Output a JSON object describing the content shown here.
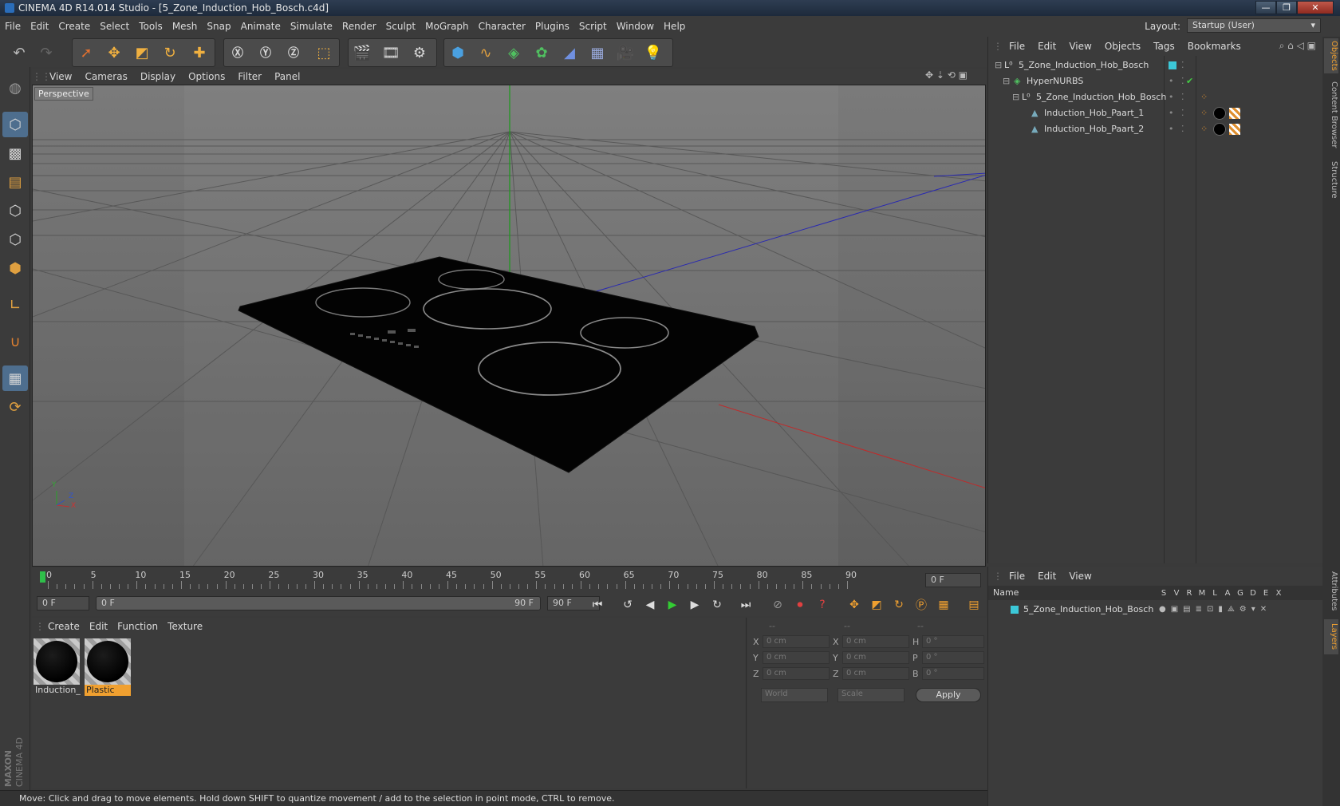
{
  "window": {
    "title": "CINEMA 4D R14.014 Studio - [5_Zone_Induction_Hob_Bosch.c4d]",
    "controls": [
      "—",
      "❐",
      "✕"
    ]
  },
  "menubar": {
    "items": [
      "File",
      "Edit",
      "Create",
      "Select",
      "Tools",
      "Mesh",
      "Snap",
      "Animate",
      "Simulate",
      "Render",
      "Sculpt",
      "MoGraph",
      "Character",
      "Plugins",
      "Script",
      "Window",
      "Help"
    ],
    "layout_label": "Layout:",
    "layout_value": "Startup (User)"
  },
  "viewport": {
    "menu": [
      "View",
      "Cameras",
      "Display",
      "Options",
      "Filter",
      "Panel"
    ],
    "label": "Perspective",
    "axis_labels": {
      "y": "Y",
      "x": "X",
      "z": "Z"
    }
  },
  "timeline": {
    "ticks": [
      "0",
      "5",
      "10",
      "15",
      "20",
      "25",
      "30",
      "35",
      "40",
      "45",
      "50",
      "55",
      "60",
      "65",
      "70",
      "75",
      "80",
      "85",
      "90"
    ],
    "current_frame": "0 F"
  },
  "transport": {
    "start_field": "0 F",
    "range_start": "0 F",
    "range_end": "90 F",
    "end_field": "90 F"
  },
  "materials": {
    "menu": [
      "Create",
      "Edit",
      "Function",
      "Texture"
    ],
    "items": [
      {
        "name": "Induction_",
        "selected": false
      },
      {
        "name": "Plastic",
        "selected": true
      }
    ]
  },
  "coordinates": {
    "headers": [
      "--",
      "--",
      "--"
    ],
    "rows": [
      {
        "a": "X",
        "av": "0 cm",
        "b": "X",
        "bv": "0 cm",
        "c": "H",
        "cv": "0 °"
      },
      {
        "a": "Y",
        "av": "0 cm",
        "b": "Y",
        "bv": "0 cm",
        "c": "P",
        "cv": "0 °"
      },
      {
        "a": "Z",
        "av": "0 cm",
        "b": "Z",
        "bv": "0 cm",
        "c": "B",
        "cv": "0 °"
      }
    ],
    "mode": "World",
    "type": "Scale",
    "apply": "Apply"
  },
  "objects": {
    "menu": [
      "File",
      "Edit",
      "View",
      "Objects",
      "Tags",
      "Bookmarks"
    ],
    "tree": [
      {
        "name": "5_Zone_Induction_Hob_Bosch",
        "level": 0
      },
      {
        "name": "HyperNURBS",
        "level": 1
      },
      {
        "name": "5_Zone_Induction_Hob_Bosch",
        "level": 2
      },
      {
        "name": "Induction_Hob_Paart_1",
        "level": 3
      },
      {
        "name": "Induction_Hob_Paart_2",
        "level": 3
      }
    ]
  },
  "layers": {
    "menu": [
      "File",
      "Edit",
      "View"
    ],
    "name_header": "Name",
    "col_headers": [
      "S",
      "V",
      "R",
      "M",
      "L",
      "A",
      "G",
      "D",
      "E",
      "X"
    ],
    "rows": [
      {
        "name": "5_Zone_Induction_Hob_Bosch"
      }
    ]
  },
  "right_tabs": [
    "Objects",
    "Content Browser",
    "Structure",
    "Attributes",
    "Layers"
  ],
  "brand": {
    "maxon": "MAXON",
    "product": "CINEMA 4D"
  },
  "status": "Move: Click and drag to move elements. Hold down SHIFT to quantize movement / add to the selection in point mode, CTRL to remove.",
  "colors": {
    "accent": "#f0a030",
    "layer_color": "#3cc8d8",
    "timeline_marker": "#2fbf4a"
  }
}
